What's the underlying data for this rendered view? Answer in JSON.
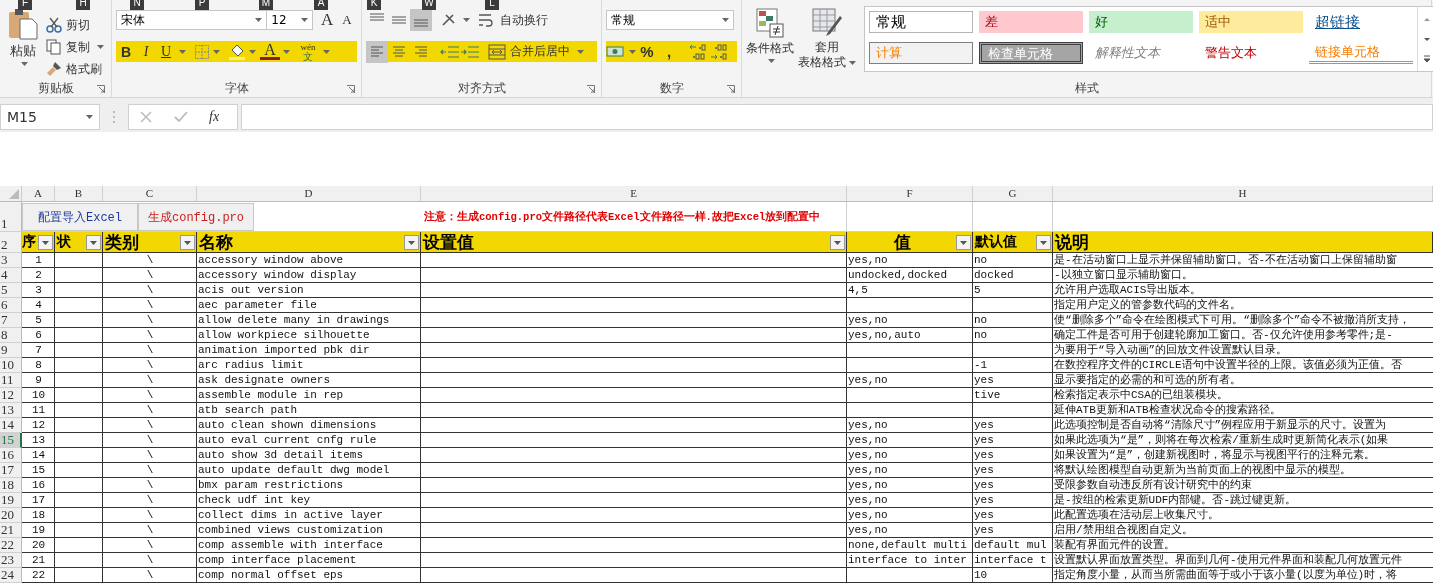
{
  "keytips": [
    "F",
    "H",
    "N",
    "P",
    "M",
    "A",
    "K",
    "W",
    "L"
  ],
  "ribbon": {
    "clipboard": {
      "label": "剪贴板",
      "paste": "粘贴",
      "cut": "剪切",
      "copy": "复制",
      "format_painter": "格式刷"
    },
    "font": {
      "label": "字体",
      "name": "宋体",
      "size": "12",
      "grow": "A",
      "shrink": "A",
      "bold": "B",
      "italic": "I",
      "underline": "U",
      "font_color": "A",
      "phonetic_top": "wén",
      "phonetic_bottom": "文"
    },
    "alignment": {
      "label": "对齐方式",
      "wrap_text": "自动换行",
      "merge_center": "合并后居中",
      "vertical": [
        {
          "kind": "top",
          "selected": false
        },
        {
          "kind": "middle",
          "selected": false
        },
        {
          "kind": "bottom",
          "selected": true
        }
      ],
      "horizontal": [
        {
          "kind": "left",
          "selected": true
        },
        {
          "kind": "center",
          "selected": false
        },
        {
          "kind": "right",
          "selected": false
        }
      ]
    },
    "number": {
      "label": "数字",
      "format": "常规",
      "percent": "%",
      "comma": ","
    },
    "styles": {
      "label": "样式",
      "conditional": "条件格式",
      "table_format": [
        "套用",
        "表格格式"
      ],
      "cells": [
        {
          "label": "常规",
          "kind": "normal"
        },
        {
          "label": "差",
          "kind": "bad"
        },
        {
          "label": "好",
          "kind": "good"
        },
        {
          "label": "适中",
          "kind": "neutral"
        },
        {
          "label": "超链接",
          "kind": "hyperlink"
        },
        {
          "label": "计算",
          "kind": "calculation"
        },
        {
          "label": "检查单元格",
          "kind": "check"
        },
        {
          "label": "解释性文本",
          "kind": "explanatory"
        },
        {
          "label": "警告文本",
          "kind": "warning"
        },
        {
          "label": "链接单元格",
          "kind": "linked"
        }
      ]
    }
  },
  "formula_bar": {
    "name_box": "M15",
    "fx": "fx"
  },
  "columns": [
    "A",
    "B",
    "C",
    "D",
    "E",
    "F",
    "G",
    "H"
  ],
  "buttons_row": {
    "row": "1",
    "buttons": [
      {
        "label": "配置导入Excel",
        "color": "#1f3a9e"
      },
      {
        "label": "生成config.pro",
        "color": "#c81e1e"
      }
    ],
    "note": "注意：生成config.pro文件路径代表Excel文件路径一样.故把Excel放到配置中"
  },
  "header_row": {
    "row": "2",
    "cells": [
      "序",
      "状",
      "类别",
      "名称",
      "设置值",
      "值",
      "默认值",
      "说明"
    ]
  },
  "rows": [
    {
      "row": "3",
      "no": "1",
      "category": "\\",
      "name": "accessory window above",
      "values": "yes,no",
      "default": "no",
      "description": "是-在活动窗口上显示并保留辅助窗口。否-不在活动窗口上保留辅助窗",
      "selected": false
    },
    {
      "row": "4",
      "no": "2",
      "category": "\\",
      "name": "accessory window display",
      "values": "undocked,docked",
      "default": "docked",
      "description": "-以独立窗口显示辅助窗口。",
      "selected": false
    },
    {
      "row": "5",
      "no": "3",
      "category": "\\",
      "name": "acis out version",
      "values": "4,5",
      "default": "5",
      "description": "允许用户选取ACIS导出版本。",
      "selected": false
    },
    {
      "row": "6",
      "no": "4",
      "category": "\\",
      "name": "aec parameter file",
      "values": "",
      "default": "",
      "description": "指定用户定义的管参数代码的文件名。",
      "selected": false
    },
    {
      "row": "7",
      "no": "5",
      "category": "\\",
      "name": "allow delete many in drawings",
      "values": "yes,no",
      "default": "no",
      "description": "使“删除多个”命令在绘图模式下可用。“删除多个”命令不被撤消所支持，",
      "selected": false
    },
    {
      "row": "8",
      "no": "6",
      "category": "\\",
      "name": "allow workpiece silhouette",
      "values": "yes,no,auto",
      "default": "no",
      "description": "确定工件是否可用于创建轮廓加工窗口。否-仅允许使用参考零件;是-",
      "selected": false
    },
    {
      "row": "9",
      "no": "7",
      "category": "\\",
      "name": "animation imported pbk dir",
      "values": "",
      "default": "",
      "description": "为要用于“导入动画”的回放文件设置默认目录。",
      "selected": false
    },
    {
      "row": "10",
      "no": "8",
      "category": "\\",
      "name": "arc radius limit",
      "values": "",
      "default": "-1",
      "description": "在数控程序文件的CIRCLE语句中设置半径的上限。该值必须为正值。否",
      "selected": false
    },
    {
      "row": "11",
      "no": "9",
      "category": "\\",
      "name": "ask designate owners",
      "values": "yes,no",
      "default": "yes",
      "description": "显示要指定的必需的和可选的所有者。",
      "selected": false
    },
    {
      "row": "12",
      "no": "10",
      "category": "\\",
      "name": "assemble module in rep",
      "values": "",
      "default": "tive",
      "description": "检索指定表示中CSA的已组装模块。",
      "selected": false
    },
    {
      "row": "13",
      "no": "11",
      "category": "\\",
      "name": "atb search path",
      "values": "",
      "default": "",
      "description": "延伸ATB更新和ATB检查状况命令的搜索路径。",
      "selected": false
    },
    {
      "row": "14",
      "no": "12",
      "category": "\\",
      "name": "auto clean shown dimensions",
      "values": "yes,no",
      "default": "yes",
      "description": "此选项控制是否自动将“清除尺寸”例程应用于新显示的尺寸。设置为",
      "selected": false
    },
    {
      "row": "15",
      "no": "13",
      "category": "\\",
      "name": "auto eval current cnfg rule",
      "values": "yes,no",
      "default": "yes",
      "description": "如果此选项为“是”，则将在每次检索/重新生成时更新简化表示(如果",
      "selected": true
    },
    {
      "row": "16",
      "no": "14",
      "category": "\\",
      "name": "auto show 3d detail items",
      "values": "yes,no",
      "default": "yes",
      "description": "如果设置为“是”，创建新视图时，将显示与视图平行的注释元素。",
      "selected": false
    },
    {
      "row": "17",
      "no": "15",
      "category": "\\",
      "name": "auto update default dwg model",
      "values": "yes,no",
      "default": "yes",
      "description": "将默认绘图模型自动更新为当前页面上的视图中显示的模型。",
      "selected": false
    },
    {
      "row": "18",
      "no": "16",
      "category": "\\",
      "name": "bmx param restrictions",
      "values": "yes,no",
      "default": "yes",
      "description": "受限参数自动违反所有设计研究中的约束",
      "selected": false
    },
    {
      "row": "19",
      "no": "17",
      "category": "\\",
      "name": "check udf int key",
      "values": "yes,no",
      "default": "yes",
      "description": "是-按组的检索更新UDF内部键。否-跳过键更新。",
      "selected": false
    },
    {
      "row": "20",
      "no": "18",
      "category": "\\",
      "name": "collect dims in active layer",
      "values": "yes,no",
      "default": "yes",
      "description": "此配置选项在活动层上收集尺寸。",
      "selected": false
    },
    {
      "row": "21",
      "no": "19",
      "category": "\\",
      "name": "combined views customization",
      "values": "yes,no",
      "default": "yes",
      "description": "启用/禁用组合视图自定义。",
      "selected": false
    },
    {
      "row": "22",
      "no": "20",
      "category": "\\",
      "name": "comp assemble with interface",
      "values": "none,default multi",
      "default": "default mul",
      "description": "装配有界面元件的设置。",
      "selected": false
    },
    {
      "row": "23",
      "no": "21",
      "category": "\\",
      "name": "comp interface placement",
      "values": "interface to inter",
      "default": "interface t",
      "description": "设置默认界面放置类型。界面到几何-使用元件界面和装配几何放置元件",
      "selected": false
    },
    {
      "row": "24",
      "no": "22",
      "category": "\\",
      "name": "comp normal offset eps",
      "values": "",
      "default": "10",
      "description": "指定角度小量，从而当所需曲面等于或小于该小量(以度为单位)时，将",
      "selected": false
    }
  ]
}
